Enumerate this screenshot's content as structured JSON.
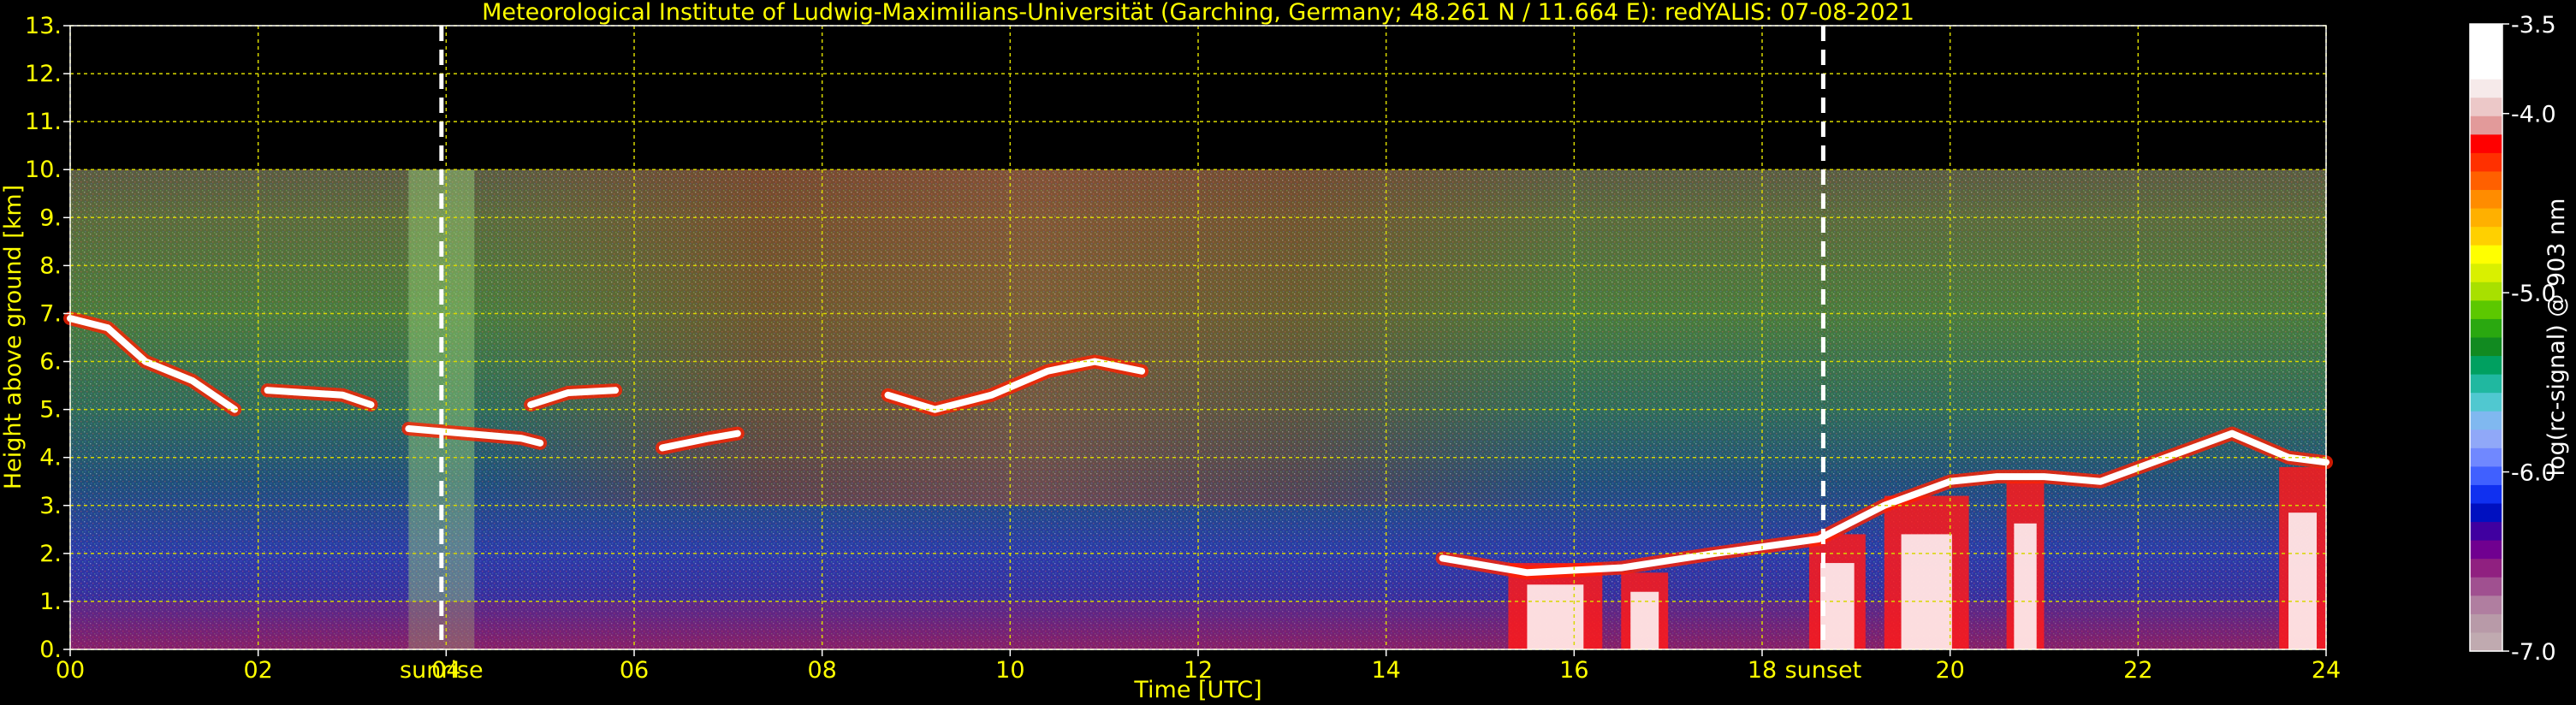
{
  "chart_data": {
    "type": "heatmap",
    "title": "Meteorological Institute of Ludwig-Maximilians-Universität (Garching, Germany; 48.261 N / 11.664 E):    redYALIS: 07-08-2021",
    "xlabel": "Time [UTC]",
    "ylabel": "Height above ground [km]",
    "xlim": [
      0,
      24
    ],
    "ylim": [
      0,
      13
    ],
    "x_ticks": [
      0,
      2,
      4,
      6,
      8,
      10,
      12,
      14,
      16,
      18,
      20,
      22,
      24
    ],
    "x_tick_labels": [
      "00",
      "02",
      "04",
      "06",
      "08",
      "10",
      "12",
      "14",
      "16",
      "18",
      "20",
      "22",
      "24"
    ],
    "y_ticks": [
      0,
      1,
      2,
      3,
      4,
      5,
      6,
      7,
      8,
      9,
      10,
      11,
      12,
      13
    ],
    "y_tick_labels": [
      "0.",
      "1.",
      "2.",
      "3.",
      "4.",
      "5.",
      "6.",
      "7.",
      "8.",
      "9.",
      "10.",
      "11.",
      "12.",
      "13."
    ],
    "grid": true,
    "data_top_km": 10,
    "events": [
      {
        "label": "sunrise",
        "time": 3.95
      },
      {
        "label": "sunset",
        "time": 18.65
      }
    ],
    "colorbar": {
      "label": "log(rc-signal) @ 903 nm",
      "range": [
        -7.0,
        -3.5
      ],
      "tick_values": [
        -3.5,
        -4.0,
        -5.0,
        -6.0,
        -7.0
      ],
      "tick_labels": [
        "-3.5",
        "-4.0",
        "-5.0",
        "-6.0",
        "-7.0"
      ],
      "colors": [
        "#ffffff",
        "#ffffff",
        "#ffffff",
        "#f6eaea",
        "#ecc8c8",
        "#e29a9a",
        "#ff0000",
        "#ff3000",
        "#ff6000",
        "#ff8c00",
        "#ffb000",
        "#ffd000",
        "#ffff00",
        "#d9f000",
        "#a8e000",
        "#5cc800",
        "#2aa810",
        "#118a20",
        "#00a060",
        "#20b8a0",
        "#50c8d0",
        "#80b8f0",
        "#90a8f8",
        "#7088ff",
        "#4060ff",
        "#1030f0",
        "#0010c0",
        "#4000a0",
        "#700090",
        "#902080",
        "#a05090",
        "#b07ea0",
        "#b89aa8",
        "#c0aab0"
      ]
    },
    "cloud_layers": [
      {
        "points": [
          [
            0.0,
            6.9
          ],
          [
            0.4,
            6.7
          ],
          [
            0.8,
            6.0
          ],
          [
            1.3,
            5.6
          ],
          [
            1.6,
            5.2
          ],
          [
            1.75,
            5.0
          ]
        ]
      },
      {
        "points": [
          [
            2.1,
            5.4
          ],
          [
            2.5,
            5.35
          ],
          [
            2.9,
            5.3
          ],
          [
            3.2,
            5.1
          ]
        ]
      },
      {
        "points": [
          [
            3.6,
            4.6
          ],
          [
            4.2,
            4.5
          ],
          [
            4.8,
            4.4
          ],
          [
            5.0,
            4.3
          ]
        ]
      },
      {
        "points": [
          [
            4.9,
            5.1
          ],
          [
            5.3,
            5.35
          ],
          [
            5.8,
            5.4
          ]
        ]
      },
      {
        "points": [
          [
            6.3,
            4.2
          ],
          [
            6.8,
            4.4
          ],
          [
            7.1,
            4.5
          ]
        ]
      },
      {
        "points": [
          [
            8.7,
            5.3
          ],
          [
            9.2,
            5.0
          ],
          [
            9.8,
            5.3
          ],
          [
            10.4,
            5.8
          ],
          [
            10.9,
            6.0
          ],
          [
            11.4,
            5.8
          ]
        ]
      },
      {
        "points": [
          [
            14.6,
            1.9
          ],
          [
            15.5,
            1.6
          ],
          [
            16.5,
            1.7
          ],
          [
            17.5,
            2.0
          ],
          [
            18.6,
            2.3
          ],
          [
            19.3,
            3.0
          ],
          [
            20.0,
            3.5
          ],
          [
            20.5,
            3.6
          ],
          [
            21.0,
            3.6
          ],
          [
            21.6,
            3.5
          ],
          [
            22.3,
            4.0
          ],
          [
            23.0,
            4.5
          ],
          [
            23.6,
            4.0
          ],
          [
            24.0,
            3.9
          ]
        ]
      }
    ],
    "precipitation_zones": [
      {
        "from": 15.3,
        "to": 16.3,
        "top_km": 1.8
      },
      {
        "from": 16.5,
        "to": 17.0,
        "top_km": 1.6
      },
      {
        "from": 18.5,
        "to": 19.1,
        "top_km": 2.4
      },
      {
        "from": 19.3,
        "to": 20.2,
        "top_km": 3.2
      },
      {
        "from": 20.6,
        "to": 21.0,
        "top_km": 3.5
      },
      {
        "from": 23.5,
        "to": 24.0,
        "top_km": 3.8
      }
    ]
  }
}
